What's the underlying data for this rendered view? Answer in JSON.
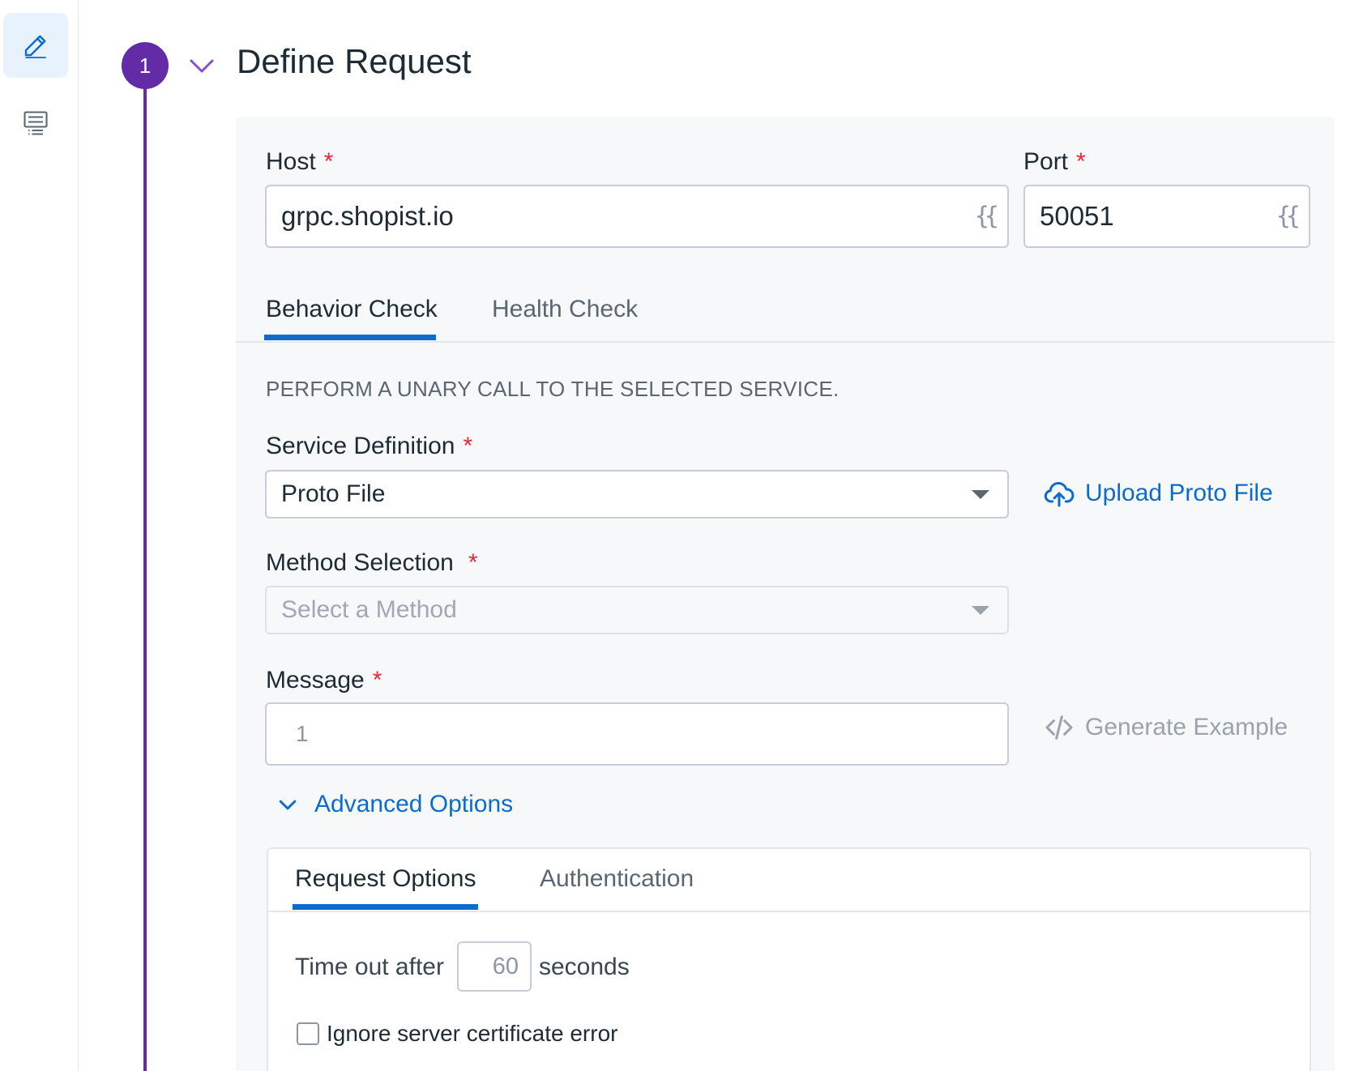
{
  "rail": {
    "items": [
      {
        "name": "edit",
        "icon": "pencil-icon",
        "active": true
      },
      {
        "name": "list",
        "icon": "list-icon",
        "active": false
      }
    ]
  },
  "step": {
    "number": "1",
    "title": "Define Request"
  },
  "host": {
    "label": "Host",
    "required": "*",
    "value": "grpc.shopist.io",
    "template_icon": "{{"
  },
  "port": {
    "label": "Port",
    "required": "*",
    "value": "50051",
    "template_icon": "{{"
  },
  "check_tabs": [
    {
      "label": "Behavior Check",
      "active": true
    },
    {
      "label": "Health Check",
      "active": false
    }
  ],
  "description": "PERFORM A UNARY CALL TO THE SELECTED SERVICE.",
  "service_definition": {
    "label": "Service Definition",
    "required": "*",
    "value": "Proto File",
    "upload_label": "Upload Proto File"
  },
  "method_selection": {
    "label": "Method Selection",
    "required": "*",
    "placeholder": "Select a Method"
  },
  "message": {
    "label": "Message",
    "required": "*",
    "line_number": "1",
    "generate_label": "Generate Example"
  },
  "advanced": {
    "toggle_label": "Advanced Options",
    "tabs": [
      {
        "label": "Request Options",
        "active": true
      },
      {
        "label": "Authentication",
        "active": false
      }
    ],
    "timeout_prefix": "Time out after",
    "timeout_value": "60",
    "timeout_suffix": "seconds",
    "ignore_cert_label": "Ignore server certificate error",
    "ignore_cert_checked": false
  },
  "colors": {
    "accent": "#632ca6",
    "link": "#0b6cce",
    "required": "#e0293a"
  }
}
